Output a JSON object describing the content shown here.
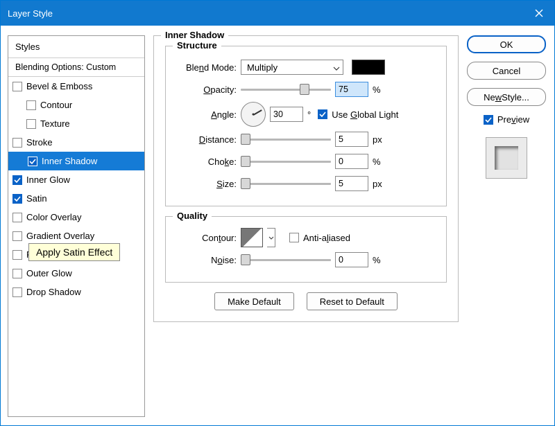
{
  "title": "Layer Style",
  "sidebar": {
    "header": "Styles",
    "subheader": "Blending Options: Custom",
    "items": [
      {
        "label": "Bevel & Emboss",
        "checked": false,
        "indent": false
      },
      {
        "label": "Contour",
        "checked": false,
        "indent": true
      },
      {
        "label": "Texture",
        "checked": false,
        "indent": true
      },
      {
        "label": "Stroke",
        "checked": false,
        "indent": false
      },
      {
        "label": "Inner Shadow",
        "checked": true,
        "indent": true,
        "selected": true
      },
      {
        "label": "Inner Glow",
        "checked": true,
        "indent": false
      },
      {
        "label": "Satin",
        "checked": true,
        "indent": false
      },
      {
        "label": "Color Overlay",
        "checked": false,
        "indent": false
      },
      {
        "label": "Gradient Overlay",
        "checked": false,
        "indent": false
      },
      {
        "label": "Pattern Overlay",
        "checked": false,
        "indent": false
      },
      {
        "label": "Outer Glow",
        "checked": false,
        "indent": false
      },
      {
        "label": "Drop Shadow",
        "checked": false,
        "indent": false
      }
    ]
  },
  "tooltip": "Apply Satin Effect",
  "panel": {
    "title": "Inner Shadow",
    "structure": {
      "legend": "Structure",
      "blend_mode_label": "Blend Mode:",
      "blend_mode_value": "Multiply",
      "opacity_label": "Opacity:",
      "opacity_value": "75",
      "opacity_unit": "%",
      "angle_label": "Angle:",
      "angle_value": "30",
      "angle_unit": "°",
      "use_global_label": "Use Global Light",
      "use_global_checked": true,
      "distance_label": "Distance:",
      "distance_value": "5",
      "distance_unit": "px",
      "choke_label": "Choke:",
      "choke_value": "0",
      "choke_unit": "%",
      "size_label": "Size:",
      "size_value": "5",
      "size_unit": "px"
    },
    "quality": {
      "legend": "Quality",
      "contour_label": "Contour:",
      "antialiased_label": "Anti-aliased",
      "antialiased_checked": false,
      "noise_label": "Noise:",
      "noise_value": "0",
      "noise_unit": "%"
    },
    "make_default": "Make Default",
    "reset_default": "Reset to Default"
  },
  "buttons": {
    "ok": "OK",
    "cancel": "Cancel",
    "new_style": "New Style...",
    "preview": "Preview"
  }
}
